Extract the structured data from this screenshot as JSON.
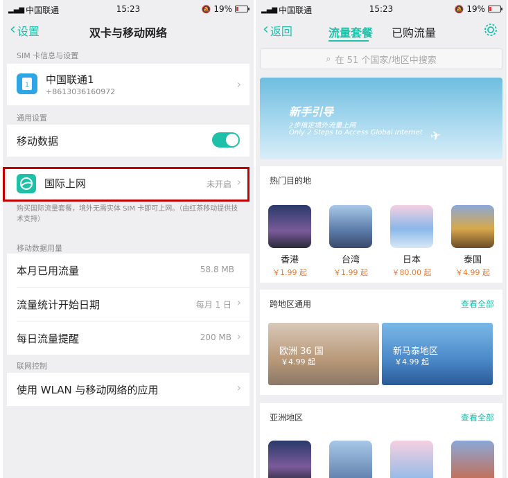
{
  "left": {
    "status": {
      "carrier": "中国联通",
      "time": "15:23",
      "battery": "19%"
    },
    "nav": {
      "back": "设置",
      "title": "双卡与移动网络"
    },
    "sim_section": "SIM 卡信息与设置",
    "sim": {
      "name": "中国联通1",
      "number": "+8613036160972",
      "slot": "1"
    },
    "general_section": "通用设置",
    "mobile_data": {
      "label": "移动数据",
      "on": true
    },
    "intl": {
      "label": "国际上网",
      "value": "未开启"
    },
    "intl_note": "购买国际流量套餐，境外无需实体 SIM 卡即可上网。（由红茶移动提供技术支持）",
    "usage_section": "移动数据用量",
    "usage": [
      {
        "label": "本月已用流量",
        "value": "58.8 MB"
      },
      {
        "label": "流量统计开始日期",
        "value": "每月 1 日"
      },
      {
        "label": "每日流量提醒",
        "value": "200 MB"
      }
    ],
    "net_section": "联网控制",
    "wlan_apps": "使用 WLAN 与移动网络的应用"
  },
  "right": {
    "status": {
      "carrier": "中国联通",
      "time": "15:23",
      "battery": "19%"
    },
    "nav": {
      "back": "返回",
      "tab_active": "流量套餐",
      "tab_other": "已购流量"
    },
    "search_placeholder": "在 51 个国家/地区中搜索",
    "banner": {
      "title": "新手引导",
      "sub_cn": "2步搞定境外流量上网",
      "sub_en": "Only 2 Steps to Access Global Internet"
    },
    "hot_title": "热门目的地",
    "hot": [
      {
        "name": "香港",
        "price": "￥1.99 起"
      },
      {
        "name": "台湾",
        "price": "￥1.99 起"
      },
      {
        "name": "日本",
        "price": "￥80.00 起"
      },
      {
        "name": "泰国",
        "price": "￥4.99 起"
      }
    ],
    "cross_title": "跨地区通用",
    "cross_more": "查看全部",
    "regions": [
      {
        "name": "欧洲 36 国",
        "price": "￥4.99 起"
      },
      {
        "name": "新马泰地区",
        "price": "￥4.99 起"
      }
    ],
    "asia_title": "亚洲地区",
    "asia_more": "查看全部"
  },
  "colors": {
    "accent": "#1ec1a8",
    "price": "#f07a2a",
    "highlight": "#c00000"
  }
}
